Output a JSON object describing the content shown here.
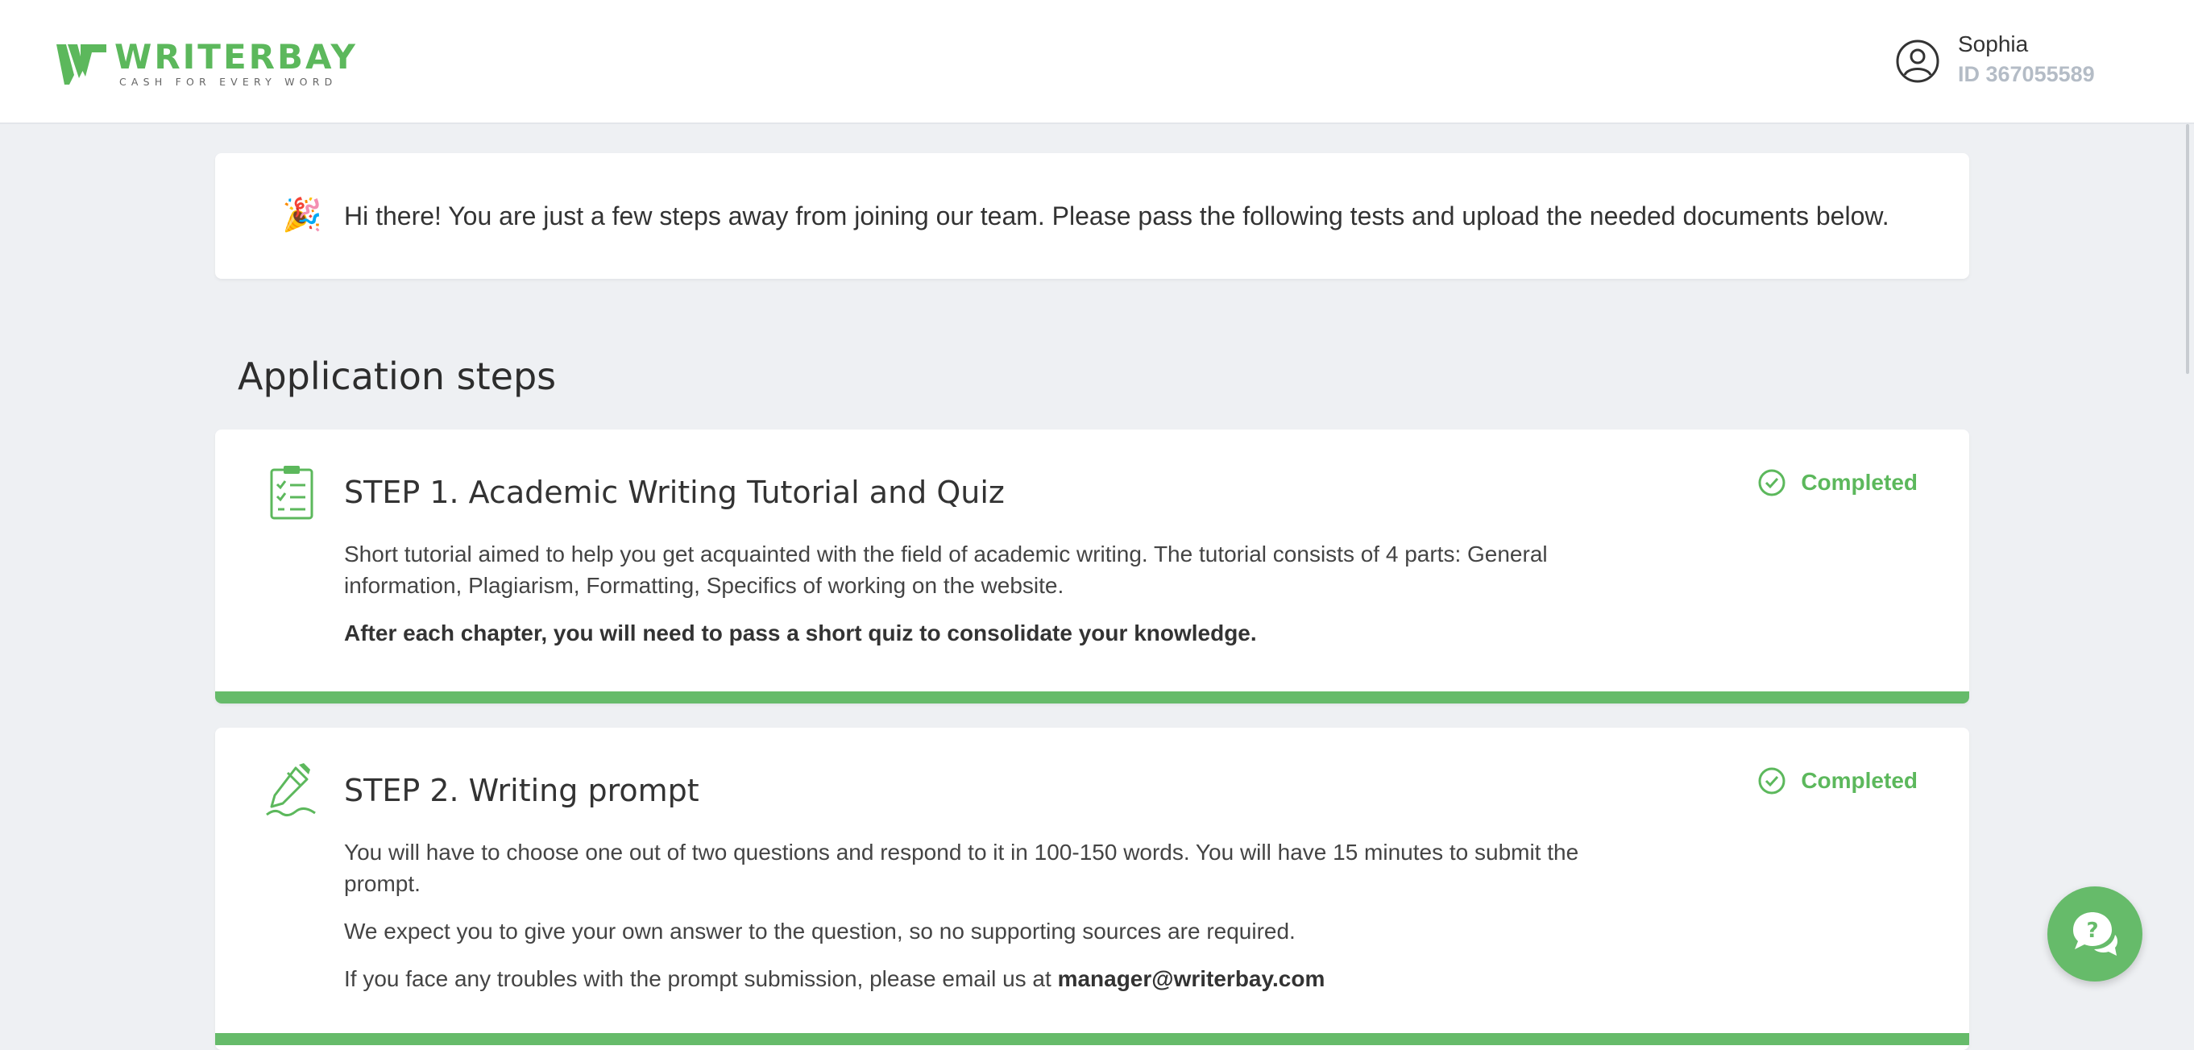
{
  "brand": {
    "name": "WRITERBAY",
    "tagline": "CASH FOR EVERY WORD",
    "color": "#5cb85c"
  },
  "user": {
    "name": "Sophia",
    "id": "ID 367055589",
    "icon": "user-circle-icon"
  },
  "welcome": {
    "emoji": "🎉",
    "text": "Hi there! You are just a few steps away from joining our team. Please pass the following tests and upload the needed documents below."
  },
  "section_title": "Application steps",
  "steps": [
    {
      "title": "STEP 1. Academic Writing Tutorial and Quiz",
      "icon": "checklist-icon",
      "status": "Completed",
      "status_icon": "check-circle-icon",
      "paragraphs": [
        "Short tutorial aimed to help you get acquainted with the field of academic writing. The tutorial consists of 4 parts: General information, Plagiarism, Formatting, Specifics of working on the website.",
        "After each chapter, you will need to pass a short quiz to consolidate your knowledge."
      ],
      "progress": 1.0
    },
    {
      "title": "STEP 2. Writing prompt",
      "icon": "pen-icon",
      "status": "Completed",
      "status_icon": "check-circle-icon",
      "paragraphs": [
        "You will have to choose one out of two questions and respond to it in 100-150 words. You will have 15 minutes to submit the prompt.",
        "We expect you to give your own answer to the question, so no supporting sources are required.",
        "If you face any troubles with the prompt submission, please email us at"
      ],
      "email": "manager@writerbay.com",
      "progress": 1.0
    }
  ],
  "chat": {
    "icon": "help-chat-icon"
  },
  "colors": {
    "accent": "#5cb85c",
    "bar": "#66bb6a",
    "background": "#eef0f3",
    "muted": "#b4bcc6"
  }
}
